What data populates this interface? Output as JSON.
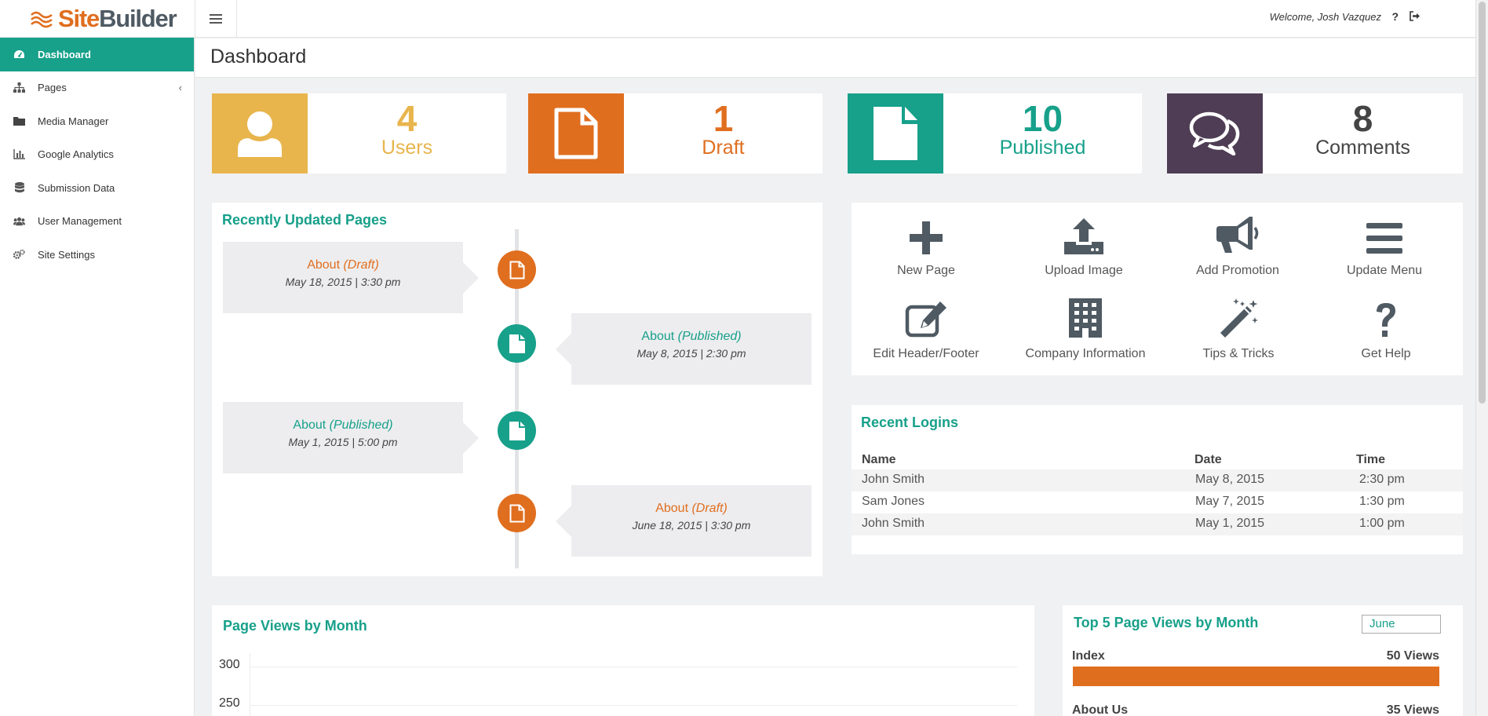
{
  "brand": {
    "name_part1": "Site",
    "name_part2": "Builder",
    "accent": "#e06e1f",
    "teal": "#17a08a"
  },
  "header": {
    "welcome": "Welcome,  Josh Vazquez",
    "help_icon": "?",
    "icons": [
      "hamburger-icon",
      "help-icon",
      "logout-icon"
    ]
  },
  "sidebar": {
    "items": [
      {
        "label": "Dashboard",
        "icon": "dashboard-icon",
        "active": true
      },
      {
        "label": "Pages",
        "icon": "sitemap-icon",
        "chevron": "‹"
      },
      {
        "label": "Media Manager",
        "icon": "folder-icon"
      },
      {
        "label": "Google Analytics",
        "icon": "bar-chart-icon"
      },
      {
        "label": "Submission Data",
        "icon": "database-icon"
      },
      {
        "label": "User Management",
        "icon": "users-icon"
      },
      {
        "label": "Site Settings",
        "icon": "gears-icon"
      }
    ]
  },
  "page": {
    "title": "Dashboard"
  },
  "stats": [
    {
      "number": "4",
      "label": "Users",
      "color": "#e8b54d",
      "icon": "user-icon"
    },
    {
      "number": "1",
      "label": "Draft",
      "color": "#e06e1f",
      "icon": "file-outline-icon"
    },
    {
      "number": "10",
      "label": "Published",
      "color": "#17a08a",
      "icon": "file-icon"
    },
    {
      "number": "8",
      "label": "Comments",
      "color": "#4e3d54",
      "icon": "comments-icon"
    }
  ],
  "recent_pages": {
    "title": "Recently Updated Pages",
    "items": [
      {
        "name": "About ",
        "status": "(Draft)",
        "date": "May 18, 2015 | 3:30 pm"
      },
      {
        "name": "About ",
        "status": "(Published)",
        "date": "May 8, 2015 | 2:30 pm"
      },
      {
        "name": "About ",
        "status": "(Published)",
        "date": "May 1, 2015 | 5:00 pm"
      },
      {
        "name": "About ",
        "status": "(Draft)",
        "date": "June 18, 2015 | 3:30 pm"
      }
    ]
  },
  "quick_actions": [
    {
      "label": "New Page",
      "icon": "plus-icon"
    },
    {
      "label": "Upload Image",
      "icon": "upload-icon"
    },
    {
      "label": "Add Promotion",
      "icon": "megaphone-icon"
    },
    {
      "label": "Update Menu",
      "icon": "menu-bars-icon"
    },
    {
      "label": "Edit Header/Footer",
      "icon": "edit-icon"
    },
    {
      "label": "Company Information",
      "icon": "building-icon"
    },
    {
      "label": "Tips & Tricks",
      "icon": "magic-wand-icon"
    },
    {
      "label": "Get Help",
      "icon": "question-icon"
    }
  ],
  "recent_logins": {
    "title": "Recent Logins",
    "columns": [
      "Name",
      "Date",
      "Time"
    ],
    "rows": [
      [
        "John Smith",
        "May 8, 2015",
        "2:30 pm"
      ],
      [
        "Sam Jones",
        "May 7, 2015",
        "1:30 pm"
      ],
      [
        "John Smith",
        "May 1, 2015",
        "1:00 pm"
      ]
    ]
  },
  "page_views": {
    "title": "Page Views by Month",
    "y_ticks": [
      "300",
      "250"
    ]
  },
  "top5": {
    "title": "Top 5 Page Views by Month",
    "month_select": "June",
    "items": [
      {
        "name": "Index",
        "views": "50 Views",
        "fraction": 1.0
      },
      {
        "name": "About Us",
        "views": "35 Views"
      }
    ]
  }
}
